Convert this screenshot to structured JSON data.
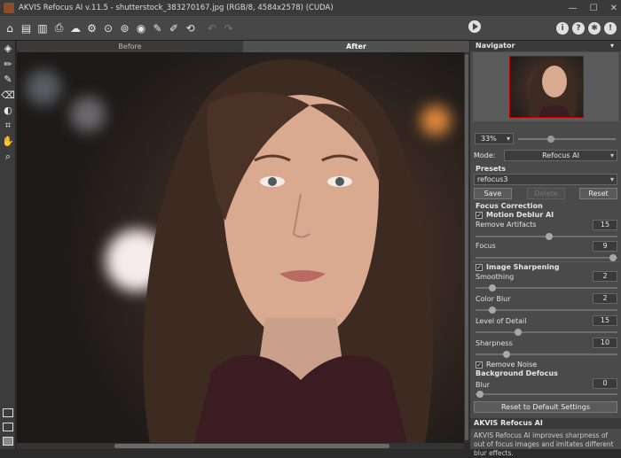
{
  "window": {
    "title": "AKVIS Refocus AI v.11.5 - shutterstock_383270167.jpg (RGB/8, 4584x2578) (CUDA)"
  },
  "canvas_tabs": [
    {
      "label": "Before"
    },
    {
      "label": "After"
    }
  ],
  "navigator": {
    "title": "Navigator",
    "zoom": "33%",
    "zoom_slider": 0.3
  },
  "settings": {
    "mode_label": "Mode:",
    "mode_value": "Refocus AI",
    "presets_title": "Presets",
    "preset_value": "refocus3",
    "save_label": "Save",
    "delete_label": "Delete",
    "reset_label": "Reset"
  },
  "focus_correction": {
    "title": "Focus Correction",
    "motion_deblur": {
      "label": "Motion Deblur AI",
      "checked": true
    },
    "params": [
      {
        "label": "Remove Artifacts",
        "value": "15",
        "pos": 0.52
      },
      {
        "label": "Focus",
        "value": "9",
        "pos": 0.98
      }
    ]
  },
  "image_sharpening": {
    "label": "Image Sharpening",
    "checked": true,
    "params": [
      {
        "label": "Smoothing",
        "value": "2",
        "pos": 0.12
      },
      {
        "label": "Color Blur",
        "value": "2",
        "pos": 0.12
      },
      {
        "label": "Level of Detail",
        "value": "15",
        "pos": 0.3
      },
      {
        "label": "Sharpness",
        "value": "10",
        "pos": 0.22
      }
    ]
  },
  "remove_noise": {
    "label": "Remove Noise",
    "checked": true
  },
  "background_defocus": {
    "title": "Background Defocus",
    "blur": {
      "label": "Blur",
      "value": "0",
      "pos": 0.0
    }
  },
  "reset_all_label": "Reset to Default Settings",
  "help": {
    "title": "AKVIS Refocus AI",
    "text": "AKVIS Refocus AI improves sharpness of out of focus images and imitates different blur effects."
  },
  "colors": {
    "accent": "#b50000",
    "panel_bg": "#4a4a4a",
    "toolbar_bg": "#474747"
  }
}
